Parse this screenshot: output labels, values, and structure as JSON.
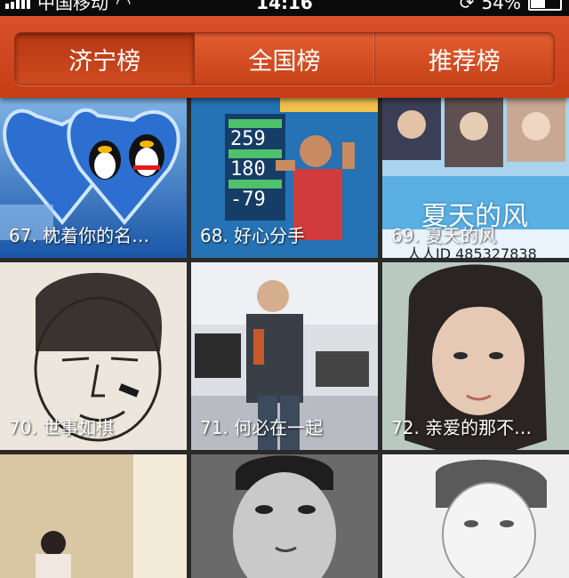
{
  "status": {
    "carrier": "中国移动",
    "time": "14:16",
    "battery": "54%",
    "battery_level": 0.54
  },
  "tabs": [
    {
      "label": "济宁榜",
      "active": true
    },
    {
      "label": "全国榜",
      "active": false
    },
    {
      "label": "推荐榜",
      "active": false
    }
  ],
  "tiles": [
    {
      "caption": "67. 枕着你的名…"
    },
    {
      "caption": "68. 好心分手",
      "scoreboard": [
        "259",
        "180",
        "-79"
      ]
    },
    {
      "caption": "69. 夏天的风",
      "overlay_title": "夏天的风",
      "overlay_id": "人人ID 485327838"
    },
    {
      "caption": "70. 世事如棋"
    },
    {
      "caption": "71. 何必在一起"
    },
    {
      "caption": "72. 亲爱的那不…"
    },
    {
      "caption": ""
    },
    {
      "caption": ""
    },
    {
      "caption": ""
    }
  ],
  "colors": {
    "accent": "#c63d16",
    "tile_bg_1": "#1f5fb0",
    "tile_bg_2": "#2c6fb8",
    "tile_bg_3": "#3b7fc3"
  }
}
